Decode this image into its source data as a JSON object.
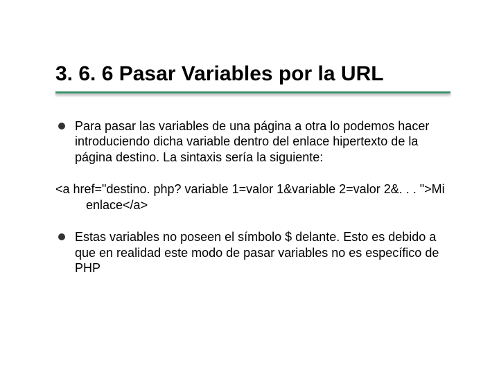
{
  "title": "3. 6. 6 Pasar Variables por la URL",
  "items": {
    "p1": "Para pasar las variables de una página a otra lo podemos hacer introduciendo dicha variable dentro del enlace hipertexto de la página destino. La sintaxis sería la siguiente:",
    "code": "<a href=\"destino. php? variable 1=valor 1&variable 2=valor 2&. . . \">Mi enlace</a>",
    "p2": "Estas variables no poseen el símbolo $ delante. Esto es debido a que en realidad este modo de pasar variables no es específico de PHP"
  }
}
